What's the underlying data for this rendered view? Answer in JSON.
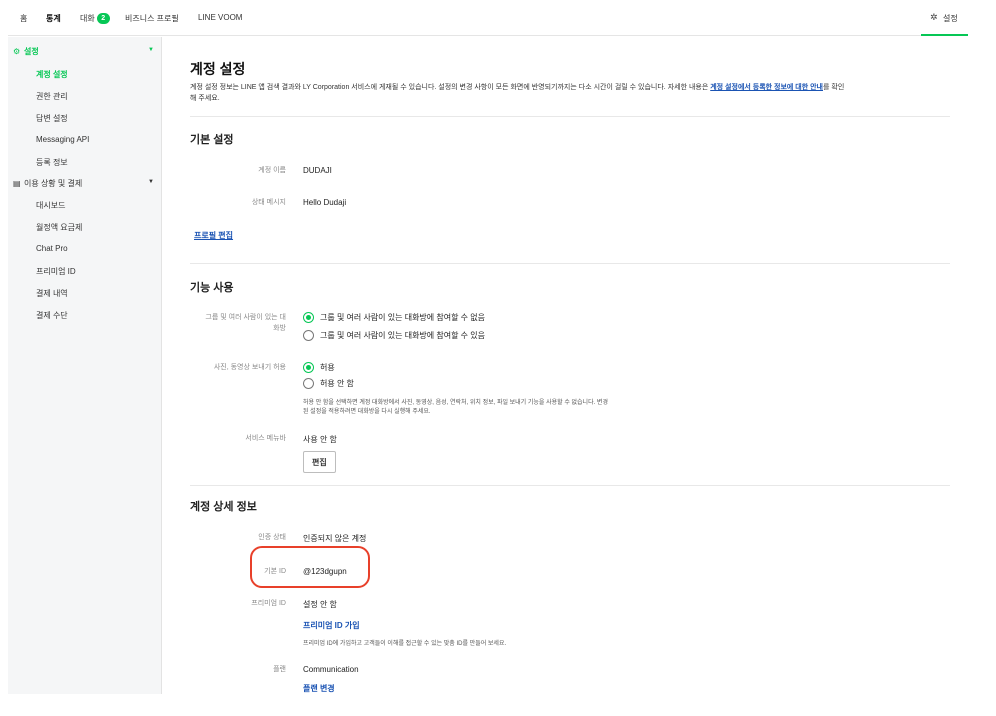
{
  "topnav": {
    "home": "홈",
    "stats": "통계",
    "chat": "대화",
    "chat_badge": "2",
    "business_profile": "비즈니스 프로필",
    "line_voom": "LINE VOOM",
    "settings": "설정"
  },
  "sidebar": {
    "group_settings": "설정",
    "items_settings": [
      "계정 설정",
      "권한 관리",
      "답변 설정",
      "Messaging API",
      "등록 정보"
    ],
    "group_billing": "이용 상황 및 결제",
    "items_billing": [
      "대시보드",
      "월정액 요금제",
      "Chat Pro",
      "프리미엄 ID",
      "결제 내역",
      "결제 수단"
    ]
  },
  "page": {
    "title": "계정 설정",
    "desc_line1": "계정 설정 정보는 LINE 앱 검색 결과와 LY Corporation 서비스에 게재될 수 있습니다. 설정의 변경 사항이 모든 화면에 반영되기까지는 다소 시간이 걸릴 수 있습니다. 자세한 내용은 ",
    "desc_link": "계정 설정에서 등록한 정보에 대한 안내",
    "desc_line2": "를 확인",
    "desc_line3": "해 주세요."
  },
  "basic": {
    "title": "기본 설정",
    "name_label": "계정 이름",
    "name_value": "DUDAJI",
    "status_label": "상태 메시지",
    "status_value": "Hello Dudaji",
    "edit_profile": "프로필 편집"
  },
  "features": {
    "title": "기능 사용",
    "group_label_1": "그룹 및 여러 사람이 있는 대",
    "group_label_2": "화방",
    "group_option_off": "그룹 및 여러 사람이 있는 대화방에 참여할 수 없음",
    "group_option_on": "그룹 및 여러 사람이 있는 대화방에 참여할 수 있음",
    "media_label": "사진, 동영상 보내기 허용",
    "media_allow": "허용",
    "media_deny": "허용 안 함",
    "media_note_1": "허용 안 함을 선택하면 계정 대화방에서 사진, 동영상, 음성, 연락처, 위치 정보, 파일 보내기 기능을 사용할 수 없습니다. 변경",
    "media_note_2": "된 설정을 적용하려면 대화방을 다시 실행해 주세요.",
    "service_menu_label": "서비스 메뉴바",
    "service_menu_value": "사용 안 함",
    "edit_button": "편집"
  },
  "details": {
    "title": "계정 상세 정보",
    "verify_label": "인증 상태",
    "verify_value": "인증되지 않은 계정",
    "basic_id_label": "기본 ID",
    "basic_id_value": "@123dgupn",
    "premium_label": "프리미엄 ID",
    "premium_value": "설정 안 함",
    "premium_link": "프리미엄 ID 가입",
    "premium_note": "프리미엄 ID에 가입하고 고객들이 이해를 접근할 수 있는 맞춤 ID를 만들어 보세요.",
    "plan_label": "플랜",
    "plan_value": "Communication",
    "plan_link": "플랜 변경"
  },
  "colors": {
    "accent": "#06c755",
    "link": "#1a53b3",
    "highlight": "#e8402a"
  }
}
